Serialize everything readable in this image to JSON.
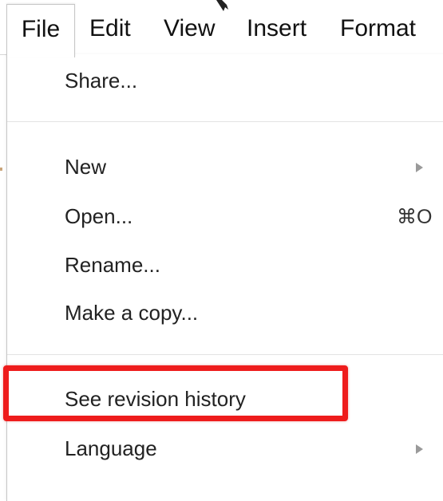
{
  "menubar": {
    "items": [
      {
        "label": "File",
        "active": true
      },
      {
        "label": "Edit"
      },
      {
        "label": "View"
      },
      {
        "label": "Insert"
      },
      {
        "label": "Format"
      }
    ]
  },
  "file_menu": {
    "items": [
      {
        "label": "Share..."
      },
      {
        "label": "New",
        "has_submenu": true
      },
      {
        "label": "Open...",
        "shortcut": "⌘O"
      },
      {
        "label": "Rename..."
      },
      {
        "label": "Make a copy..."
      },
      {
        "label": "See revision history",
        "highlighted": true
      },
      {
        "label": "Language",
        "has_submenu": true
      }
    ]
  },
  "colors": {
    "highlight_border": "#ee1c1c",
    "menu_border": "#c6c6c6",
    "separator": "#e3e3e3"
  }
}
